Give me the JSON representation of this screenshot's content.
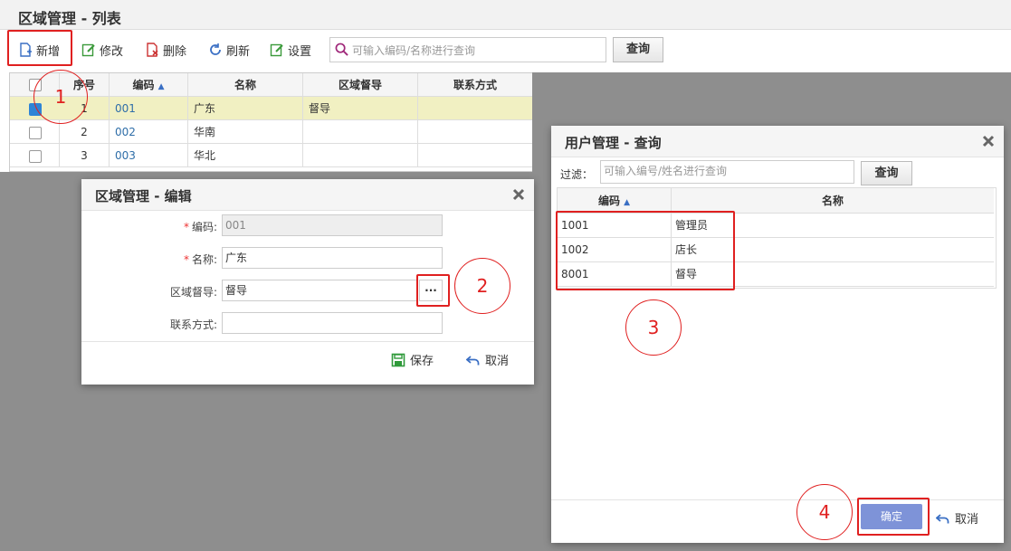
{
  "main": {
    "title": "区域管理 - 列表",
    "toolbar": {
      "add": "新增",
      "edit": "修改",
      "delete": "删除",
      "refresh": "刷新",
      "settings": "设置",
      "search_placeholder": "可输入编码/名称进行查询",
      "query": "查询"
    },
    "grid": {
      "headers": [
        "序号",
        "编码",
        "名称",
        "区域督导",
        "联系方式"
      ],
      "rows": [
        {
          "index": "1",
          "code": "001",
          "name": "广东",
          "supervisor": "督导",
          "contact": ""
        },
        {
          "index": "2",
          "code": "002",
          "name": "华南",
          "supervisor": "",
          "contact": ""
        },
        {
          "index": "3",
          "code": "003",
          "name": "华北",
          "supervisor": "",
          "contact": ""
        }
      ]
    }
  },
  "edit_dialog": {
    "title": "区域管理 - 编辑",
    "code_label": "编码:",
    "code_value": "001",
    "name_label": "名称:",
    "name_value": "广东",
    "supervisor_label": "区域督导:",
    "supervisor_value": "督导",
    "ellipsis": "···",
    "contact_label": "联系方式:",
    "contact_value": "",
    "save": "保存",
    "cancel": "取消"
  },
  "user_dialog": {
    "title": "用户管理 - 查询",
    "filter_label": "过滤：",
    "filter_placeholder": "可输入编号/姓名进行查询",
    "query": "查询",
    "headers": [
      "编码",
      "名称"
    ],
    "rows": [
      {
        "code": "1001",
        "name": "管理员"
      },
      {
        "code": "1002",
        "name": "店长"
      },
      {
        "code": "8001",
        "name": "督导"
      }
    ],
    "ok": "确定",
    "cancel": "取消"
  },
  "annotations": [
    "1",
    "2",
    "3",
    "4"
  ],
  "colors": {
    "accent": "#2e84d6",
    "highlight_row": "#f1f0c2",
    "annotation": "#e02020",
    "ok_button": "#7e93d8"
  }
}
